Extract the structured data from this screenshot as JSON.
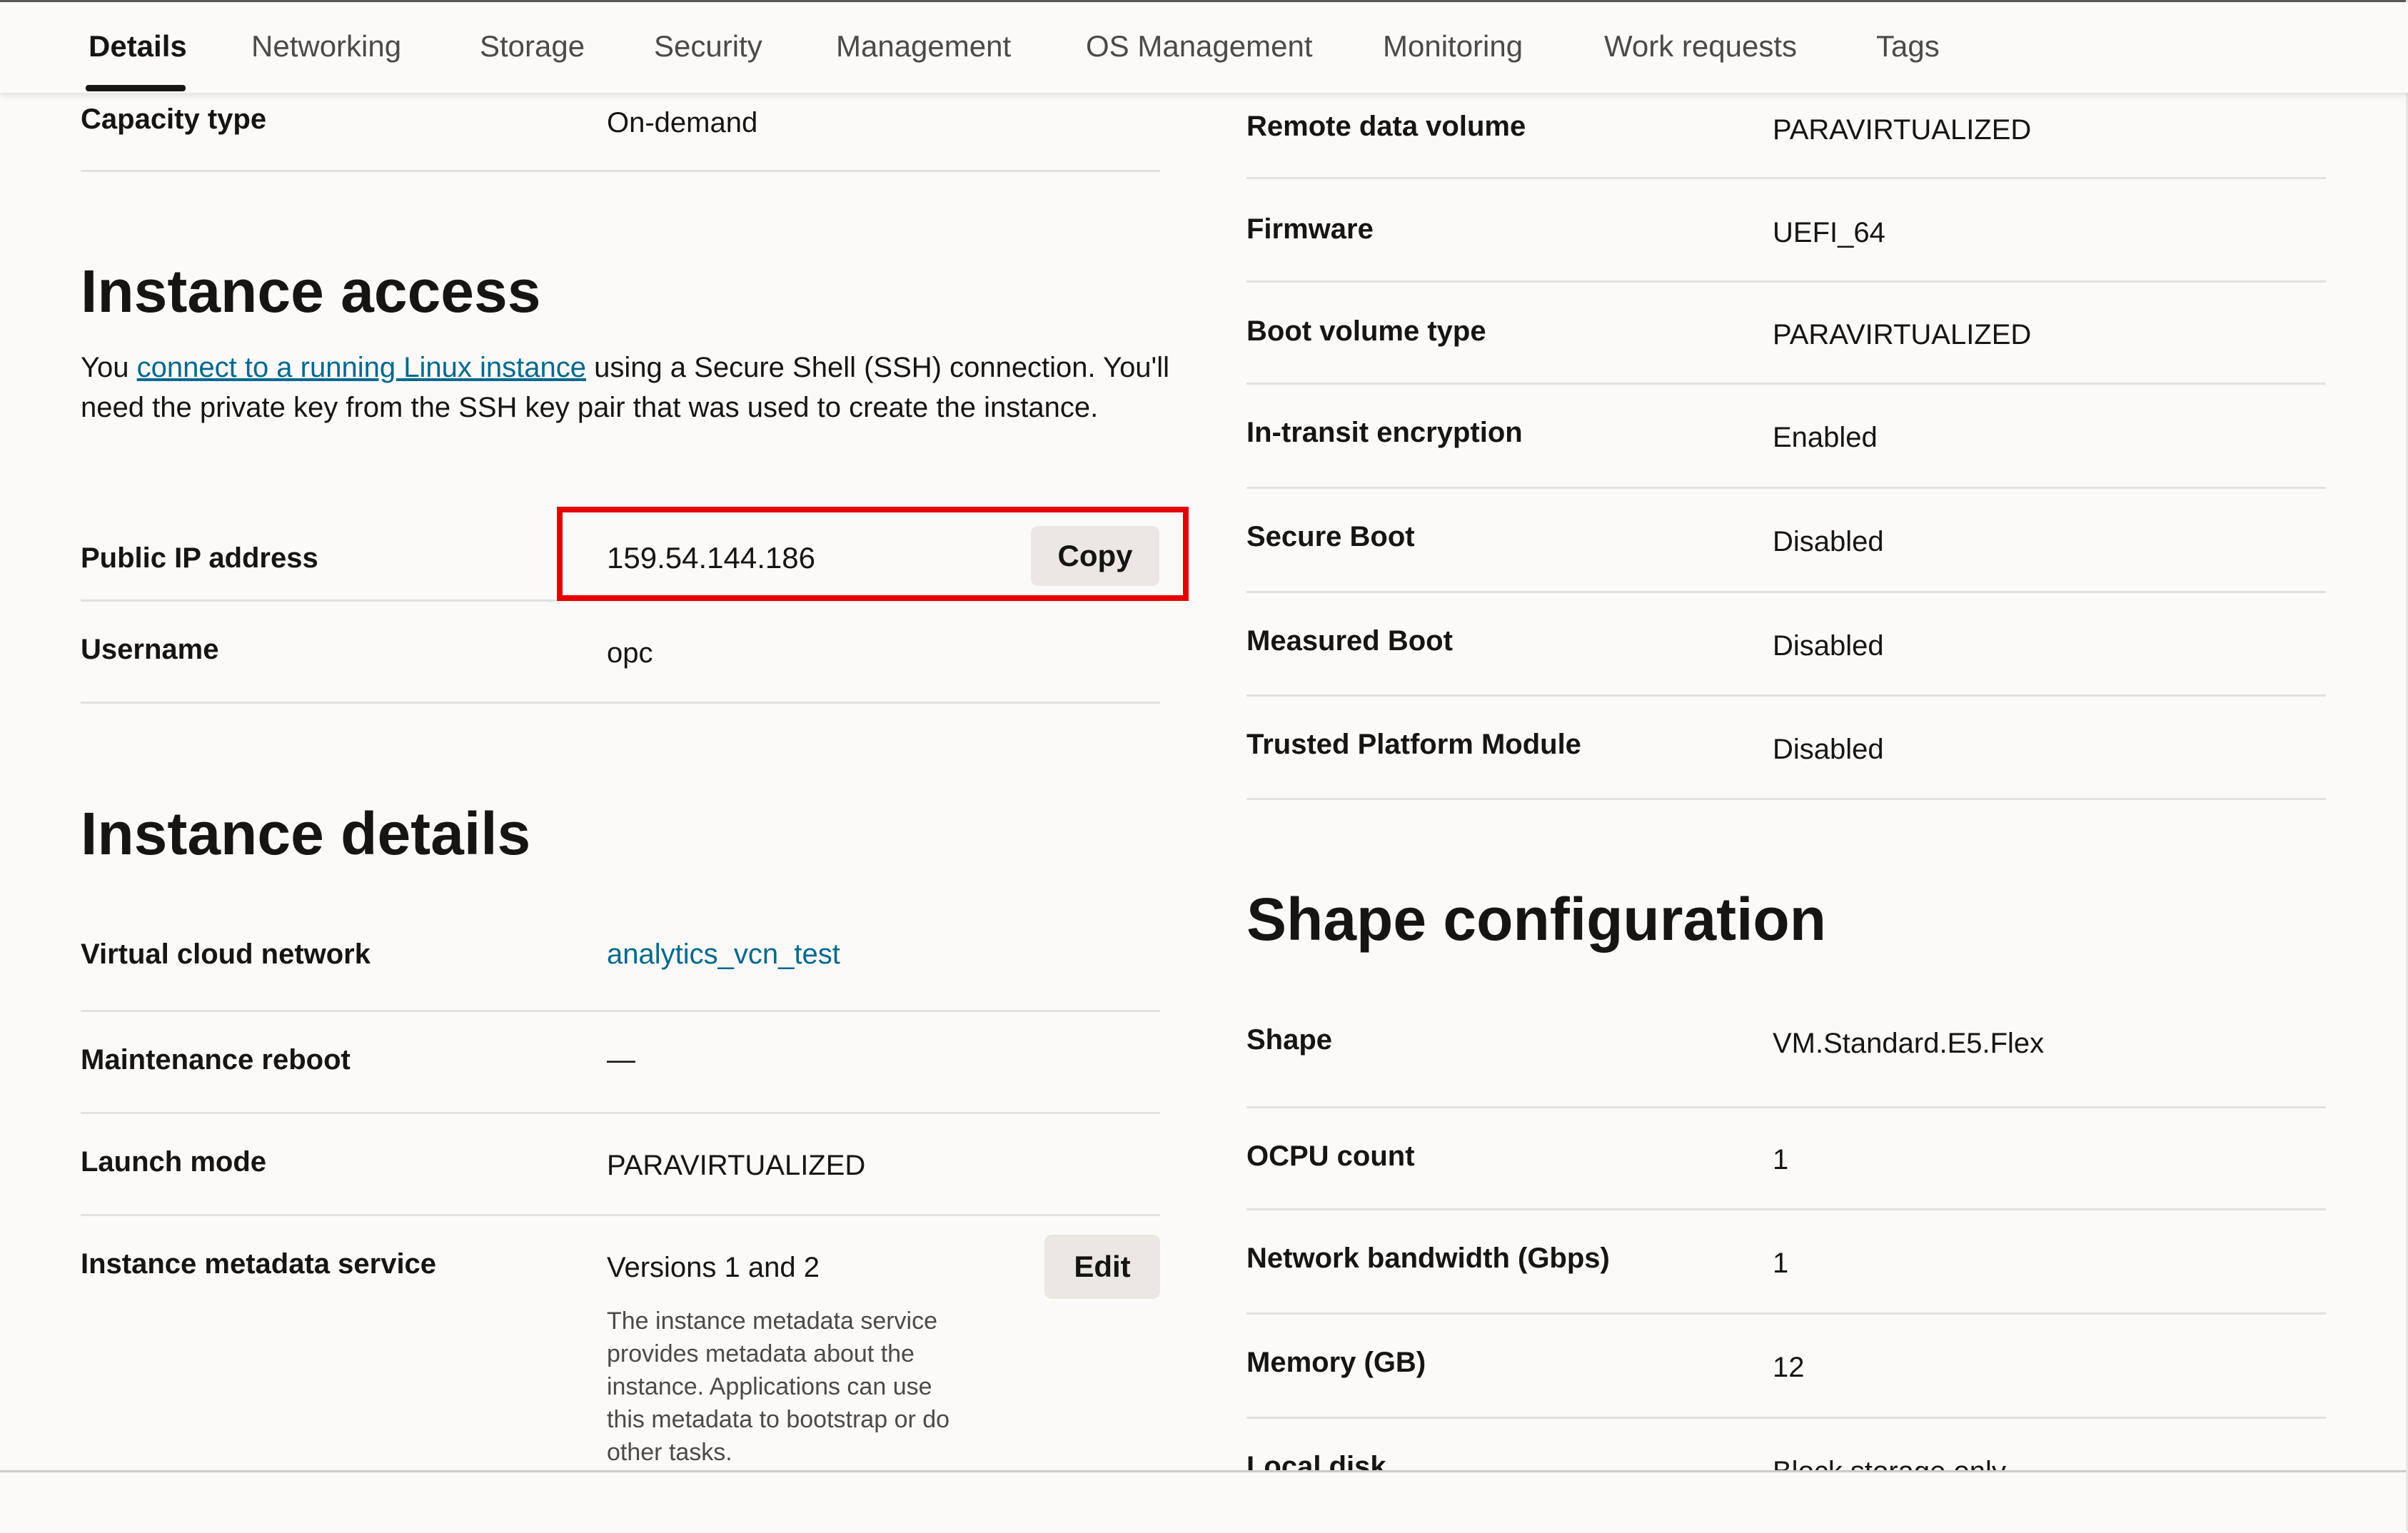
{
  "tabs": [
    {
      "label": "Details",
      "active": true
    },
    {
      "label": "Networking"
    },
    {
      "label": "Storage"
    },
    {
      "label": "Security"
    },
    {
      "label": "Management"
    },
    {
      "label": "OS Management"
    },
    {
      "label": "Monitoring"
    },
    {
      "label": "Work requests"
    },
    {
      "label": "Tags"
    }
  ],
  "left": {
    "capacity_type": {
      "label": "Capacity type",
      "value": "On-demand"
    },
    "instance_access": {
      "title": "Instance access",
      "text_before": "You ",
      "link_text": "connect to a running Linux instance",
      "text_after": " using a Secure Shell (SSH) connection. You'll need the private key from the SSH key pair that was used to create the instance.",
      "public_ip": {
        "label": "Public IP address",
        "value": "159.54.144.186",
        "copy_label": "Copy"
      },
      "username": {
        "label": "Username",
        "value": "opc"
      }
    },
    "instance_details": {
      "title": "Instance details",
      "vcn": {
        "label": "Virtual cloud network",
        "value": "analytics_vcn_test"
      },
      "maintenance_reboot": {
        "label": "Maintenance reboot",
        "value": "—"
      },
      "launch_mode": {
        "label": "Launch mode",
        "value": "PARAVIRTUALIZED"
      },
      "metadata_service": {
        "label": "Instance metadata service",
        "value": "Versions 1 and 2",
        "edit_label": "Edit",
        "description": "The instance metadata service provides metadata about the instance. Applications can use this metadata to bootstrap or do other tasks."
      }
    }
  },
  "right": {
    "rows": [
      {
        "label": "Remote data volume",
        "value": "PARAVIRTUALIZED"
      },
      {
        "label": "Firmware",
        "value": "UEFI_64"
      },
      {
        "label": "Boot volume type",
        "value": "PARAVIRTUALIZED"
      },
      {
        "label": "In-transit encryption",
        "value": "Enabled"
      },
      {
        "label": "Secure Boot",
        "value": "Disabled"
      },
      {
        "label": "Measured Boot",
        "value": "Disabled"
      },
      {
        "label": "Trusted Platform Module",
        "value": "Disabled"
      }
    ],
    "shape_configuration": {
      "title": "Shape configuration",
      "rows": [
        {
          "label": "Shape",
          "value": "VM.Standard.E5.Flex"
        },
        {
          "label": "OCPU count",
          "value": "1"
        },
        {
          "label": "Network bandwidth (Gbps)",
          "value": "1"
        },
        {
          "label": "Memory (GB)",
          "value": "12"
        },
        {
          "label": "Local disk",
          "value": "Block storage only"
        }
      ]
    }
  },
  "colors": {
    "link": "#00688c",
    "highlight": "#e50000"
  }
}
